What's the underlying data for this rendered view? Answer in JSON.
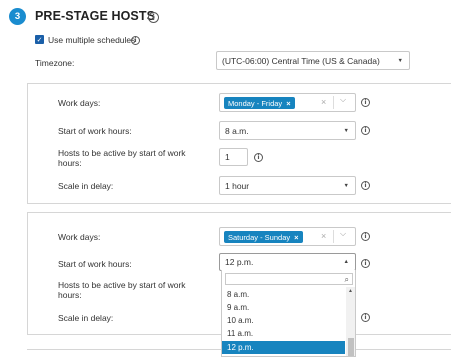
{
  "section": {
    "step_number": "3",
    "title": "PRE-STAGE HOSTS",
    "info_icon": "info-icon"
  },
  "use_multiple_schedules": {
    "checked": true,
    "label": "Use multiple schedules"
  },
  "timezone": {
    "label": "Timezone:",
    "value": "(UTC-06:00) Central Time (US & Canada)"
  },
  "schedules": [
    {
      "work_days_label": "Work days:",
      "work_days_tags": [
        "Monday - Friday"
      ],
      "start_label": "Start of work hours:",
      "start_value": "8 a.m.",
      "hosts_label_line1": "Hosts to be active by start of work",
      "hosts_label_line2": "hours:",
      "hosts_value": "1",
      "scale_label": "Scale in delay:",
      "scale_value": "1 hour"
    },
    {
      "work_days_label": "Work days:",
      "work_days_tags": [
        "Saturday - Sunday"
      ],
      "start_label": "Start of work hours:",
      "start_value": "12 p.m.",
      "hosts_label_line1": "Hosts to be active by start of work",
      "hosts_label_line2": "hours:",
      "scale_label": "Scale in delay:"
    }
  ],
  "dropdown": {
    "search_value": "",
    "options": [
      "8 a.m.",
      "9 a.m.",
      "10 a.m.",
      "11 a.m.",
      "12 p.m."
    ],
    "selected": "12 p.m."
  },
  "glyphs": {
    "check": "✓",
    "info": "i",
    "caret_down": "▼",
    "caret_up": "▲",
    "tag_remove": "×",
    "clear": "×",
    "chevron": "⌵",
    "search": "⌕"
  },
  "colors": {
    "accent": "#1a8ccf",
    "tag": "#1784bf",
    "checkbox": "#1a5fa8"
  }
}
